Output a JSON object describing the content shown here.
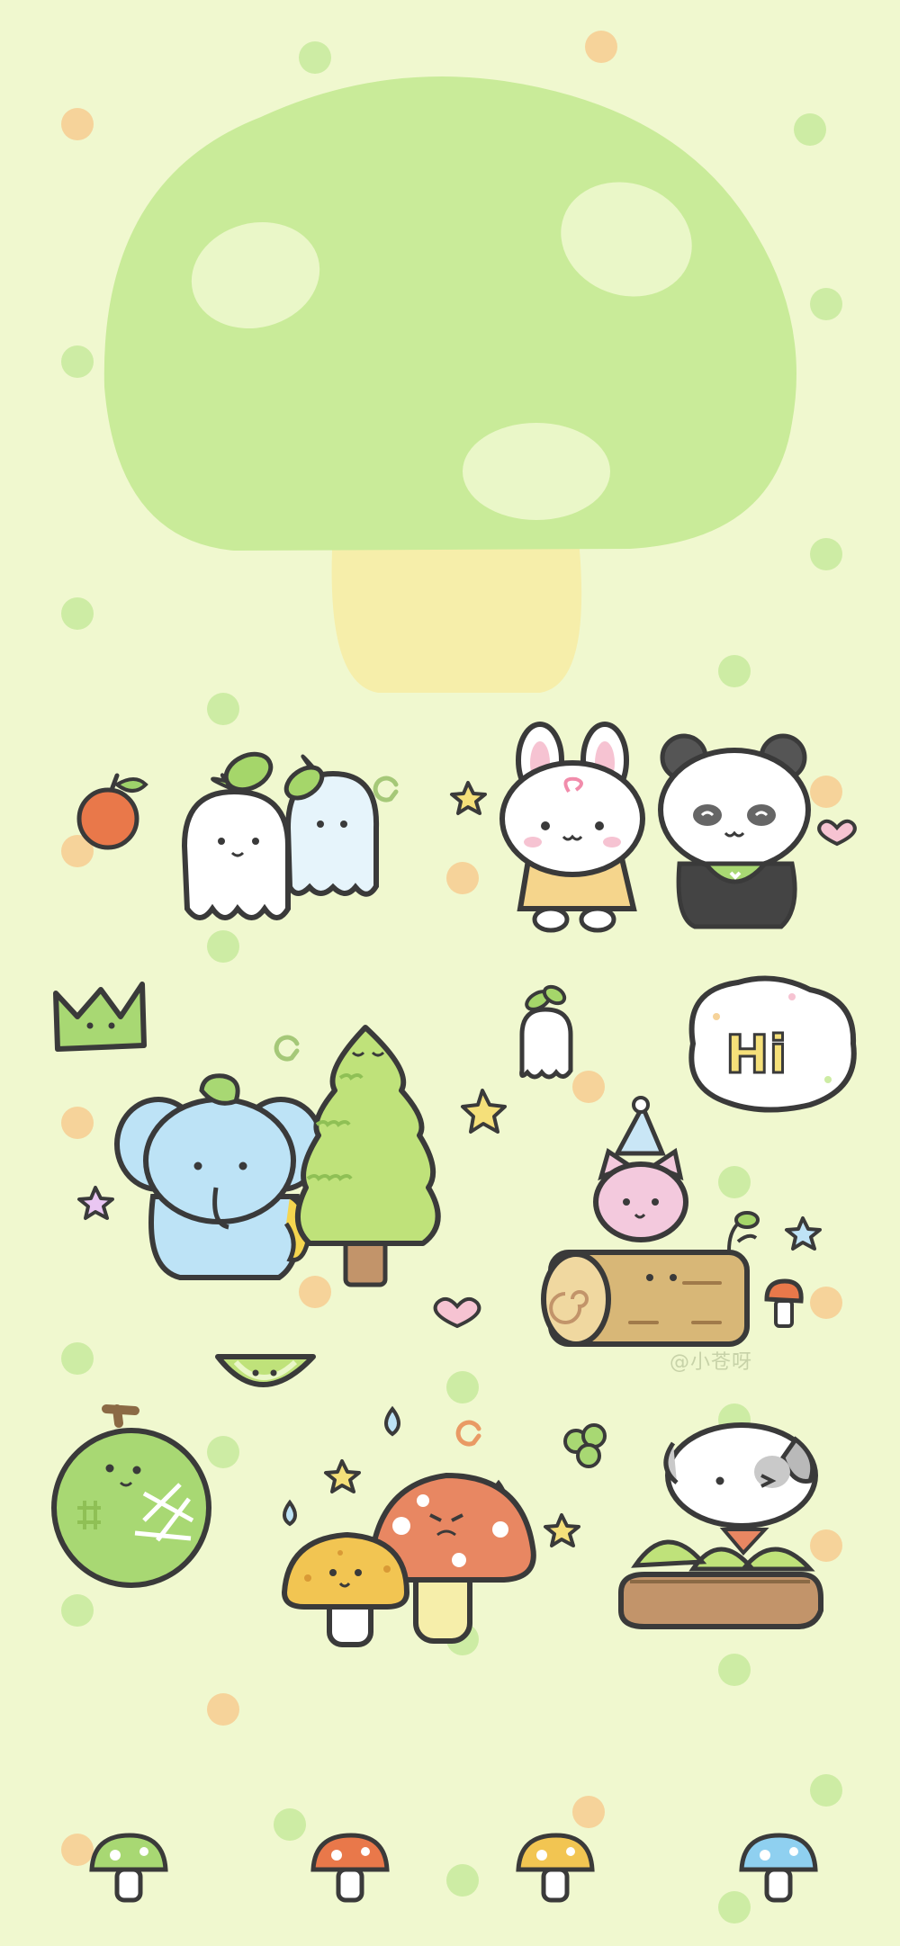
{
  "wallpaper": {
    "bubble_text": "Hi",
    "watermark": "@小苍呀",
    "colors": {
      "background": "#f0f8cf",
      "mushroom_cap": "#c9eb99",
      "mushroom_stem": "#f6eeaa",
      "outline": "#3a3a3a",
      "dot_orange": "#f6d39a",
      "dot_green": "#cdeca4"
    },
    "characters": [
      "apple",
      "sprout-ghosts",
      "bunny",
      "panda",
      "crown",
      "sprout-ghost-small",
      "hi-bubble",
      "elephant",
      "pine-tree",
      "cat-with-party-hat",
      "log",
      "melon-slice",
      "melon",
      "yellow-mushroom",
      "orange-mushroom",
      "puppy-eating-melon",
      "clover"
    ],
    "bottom_mushrooms": [
      "green",
      "orange",
      "yellow",
      "blue"
    ]
  }
}
